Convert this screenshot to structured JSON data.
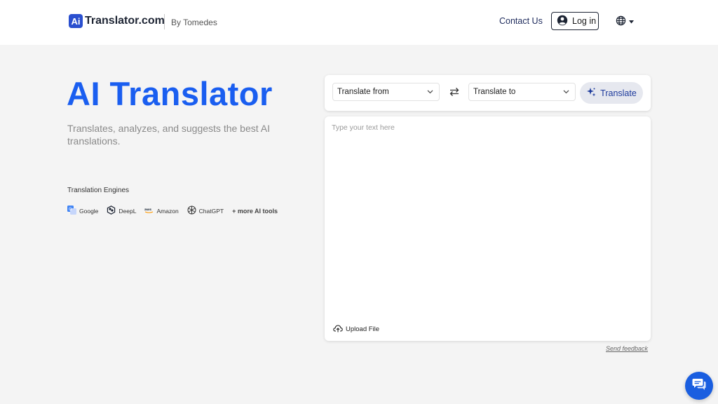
{
  "header": {
    "logo_badge": "Ai",
    "logo_text": "Translator.com",
    "by_text": "By Tomedes",
    "contact_label": "Contact Us",
    "login_label": "Log in",
    "lang_icon": "globe-icon"
  },
  "hero": {
    "title": "AI Translator",
    "subtitle": "Translates, analyzes, and suggests the best AI translations.",
    "engines_label": "Translation Engines",
    "engines": [
      "Google",
      "DeepL",
      "Amazon",
      "ChatGPT"
    ],
    "more_tools": "+ more AI tools"
  },
  "translator": {
    "from_label": "Translate from",
    "to_label": "Translate to",
    "translate_button": "Translate",
    "input_placeholder": "Type your text here",
    "upload_label": "Upload File"
  },
  "feedback_label": "Send feedback",
  "colors": {
    "accent": "#1a5ef0",
    "logo_badge": "#2a4fcf",
    "translate_button_bg": "#e6e8ef",
    "chat_button": "#1a5ee0",
    "page_bg": "#f4f4f4"
  }
}
